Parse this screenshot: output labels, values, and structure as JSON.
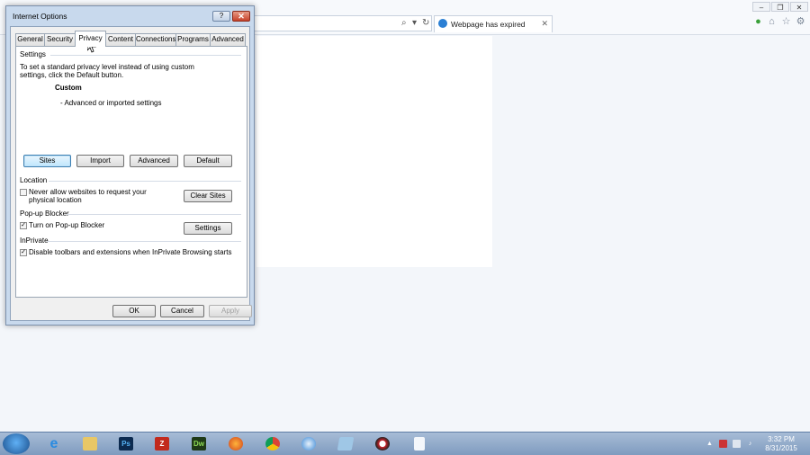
{
  "browser": {
    "tab_title": "Webpage has expired",
    "tab_close": "✕",
    "window_controls": [
      "–",
      "❐",
      "✕"
    ],
    "toolbar_icons": [
      "home-icon",
      "favorites-star-icon",
      "tools-gear-icon"
    ]
  },
  "dialog": {
    "title": "Internet Options",
    "help": "?",
    "close": "✕",
    "tabs": [
      "General",
      "Security",
      "Privacy",
      "Content",
      "Connections",
      "Programs",
      "Advanced"
    ],
    "active_tab": "Privacy",
    "settings": {
      "heading": "Settings",
      "description_line1": "To set a standard privacy level instead of using custom",
      "description_line2": "settings, click the Default button.",
      "level": "Custom",
      "level_detail": "- Advanced or imported settings",
      "buttons": {
        "sites": "Sites",
        "import": "Import",
        "advanced": "Advanced",
        "default": "Default"
      }
    },
    "location": {
      "heading": "Location",
      "checkbox_line1": "Never allow websites to request your",
      "checkbox_line2": "physical location",
      "checked": false,
      "button": "Clear Sites"
    },
    "popup": {
      "heading": "Pop-up Blocker",
      "checkbox": "Turn on Pop-up Blocker",
      "checked": true,
      "button": "Settings"
    },
    "inprivate": {
      "heading": "InPrivate",
      "checkbox": "Disable toolbars and extensions when InPrivate Browsing starts",
      "checked": true
    },
    "footer": {
      "ok": "OK",
      "cancel": "Cancel",
      "apply": "Apply"
    }
  },
  "taskbar": {
    "apps": [
      "internet-explorer",
      "file-explorer",
      "photoshop",
      "filezilla",
      "dreamweaver",
      "firefox",
      "chrome",
      "safari",
      "app",
      "app",
      "document"
    ],
    "app_labels": {
      "photoshop": "Ps",
      "dreamweaver": "Dw",
      "filezilla": "Z"
    },
    "time": "3:32 PM",
    "date": "8/31/2015"
  }
}
